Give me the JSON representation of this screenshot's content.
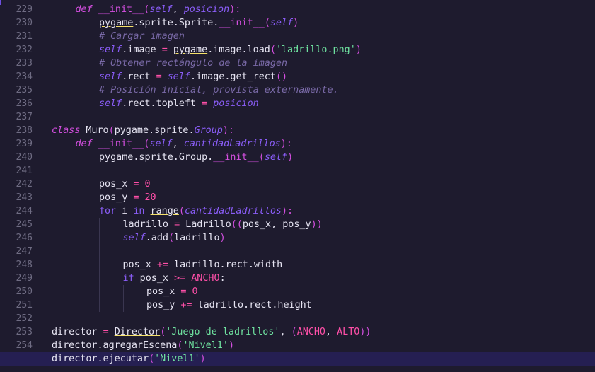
{
  "colors": {
    "background": "#1e1b2e",
    "active_line": "#251f52",
    "line_number": "#6f6c83",
    "keyword": "#d44fe0",
    "self": "#8a5df7",
    "string": "#6fe2a0",
    "number": "#ff4fa8",
    "comment": "#7a6aa8",
    "text": "#e6e4f2"
  },
  "editor": {
    "active_line": 255,
    "lines": [
      {
        "n": "229",
        "indent": 1,
        "tokens": [
          [
            "kw",
            "def "
          ],
          [
            "magic",
            "__init__"
          ],
          [
            "punc",
            "("
          ],
          [
            "self",
            "self"
          ],
          [
            "txt",
            ", "
          ],
          [
            "param",
            "posicion"
          ],
          [
            "punc",
            "):"
          ]
        ]
      },
      {
        "n": "230",
        "indent": 2,
        "tokens": [
          [
            "mod",
            "pygame"
          ],
          [
            "txt",
            ".sprite.Sprite."
          ],
          [
            "magic",
            "__init__"
          ],
          [
            "punc",
            "("
          ],
          [
            "self",
            "self"
          ],
          [
            "punc",
            ")"
          ]
        ]
      },
      {
        "n": "231",
        "indent": 2,
        "tokens": [
          [
            "cmt",
            "# Cargar imagen"
          ]
        ]
      },
      {
        "n": "232",
        "indent": 2,
        "tokens": [
          [
            "self",
            "self"
          ],
          [
            "txt",
            ".image "
          ],
          [
            "op",
            "="
          ],
          [
            "txt",
            " "
          ],
          [
            "mod",
            "pygame"
          ],
          [
            "txt",
            ".image.load"
          ],
          [
            "punc",
            "("
          ],
          [
            "str",
            "'ladrillo.png'"
          ],
          [
            "punc",
            ")"
          ]
        ]
      },
      {
        "n": "233",
        "indent": 2,
        "tokens": [
          [
            "cmt",
            "# Obtener rectángulo de la imagen"
          ]
        ]
      },
      {
        "n": "234",
        "indent": 2,
        "tokens": [
          [
            "self",
            "self"
          ],
          [
            "txt",
            ".rect "
          ],
          [
            "op",
            "="
          ],
          [
            "txt",
            " "
          ],
          [
            "self",
            "self"
          ],
          [
            "txt",
            ".image.get_rect"
          ],
          [
            "punc",
            "()"
          ]
        ]
      },
      {
        "n": "235",
        "indent": 2,
        "tokens": [
          [
            "cmt",
            "# Posición inicial, provista externamente."
          ]
        ]
      },
      {
        "n": "236",
        "indent": 2,
        "tokens": [
          [
            "self",
            "self"
          ],
          [
            "txt",
            ".rect.topleft "
          ],
          [
            "op",
            "="
          ],
          [
            "txt",
            " "
          ],
          [
            "param",
            "posicion"
          ]
        ]
      },
      {
        "n": "237",
        "indent": 0,
        "tokens": []
      },
      {
        "n": "238",
        "indent": 0,
        "tokens": [
          [
            "kw",
            "class "
          ],
          [
            "cls",
            "Muro"
          ],
          [
            "punc",
            "("
          ],
          [
            "mod",
            "pygame"
          ],
          [
            "txt",
            ".sprite."
          ],
          [
            "it",
            "Group"
          ],
          [
            "punc",
            "):"
          ]
        ]
      },
      {
        "n": "239",
        "indent": 1,
        "tokens": [
          [
            "kw",
            "def "
          ],
          [
            "magic",
            "__init__"
          ],
          [
            "punc",
            "("
          ],
          [
            "self",
            "self"
          ],
          [
            "txt",
            ", "
          ],
          [
            "param",
            "cantidadLadrillos"
          ],
          [
            "punc",
            "):"
          ]
        ]
      },
      {
        "n": "240",
        "indent": 2,
        "tokens": [
          [
            "mod",
            "pygame"
          ],
          [
            "txt",
            ".sprite.Group."
          ],
          [
            "magic",
            "__init__"
          ],
          [
            "punc",
            "("
          ],
          [
            "self",
            "self"
          ],
          [
            "punc",
            ")"
          ]
        ]
      },
      {
        "n": "241",
        "indent": 0,
        "tokens": []
      },
      {
        "n": "242",
        "indent": 2,
        "tokens": [
          [
            "txt",
            "pos_x "
          ],
          [
            "op",
            "="
          ],
          [
            "txt",
            " "
          ],
          [
            "num",
            "0"
          ]
        ]
      },
      {
        "n": "243",
        "indent": 2,
        "tokens": [
          [
            "txt",
            "pos_y "
          ],
          [
            "op",
            "="
          ],
          [
            "txt",
            " "
          ],
          [
            "num",
            "20"
          ]
        ]
      },
      {
        "n": "244",
        "indent": 2,
        "tokens": [
          [
            "kw2",
            "for"
          ],
          [
            "txt",
            " i "
          ],
          [
            "kw2",
            "in"
          ],
          [
            "txt",
            " "
          ],
          [
            "mod",
            "range"
          ],
          [
            "punc",
            "("
          ],
          [
            "param",
            "cantidadLadrillos"
          ],
          [
            "punc",
            "):"
          ]
        ]
      },
      {
        "n": "245",
        "indent": 3,
        "tokens": [
          [
            "txt",
            "ladrillo "
          ],
          [
            "op",
            "="
          ],
          [
            "txt",
            " "
          ],
          [
            "cls",
            "Ladrillo"
          ],
          [
            "punc",
            "(("
          ],
          [
            "txt",
            "pos_x, pos_y"
          ],
          [
            "punc",
            "))"
          ]
        ]
      },
      {
        "n": "246",
        "indent": 3,
        "tokens": [
          [
            "self",
            "self"
          ],
          [
            "txt",
            ".add"
          ],
          [
            "punc",
            "("
          ],
          [
            "txt",
            "ladrillo"
          ],
          [
            "punc",
            ")"
          ]
        ]
      },
      {
        "n": "247",
        "indent": 0,
        "tokens": []
      },
      {
        "n": "248",
        "indent": 3,
        "tokens": [
          [
            "txt",
            "pos_x "
          ],
          [
            "op",
            "+="
          ],
          [
            "txt",
            " ladrillo.rect.width"
          ]
        ]
      },
      {
        "n": "249",
        "indent": 3,
        "tokens": [
          [
            "kw2",
            "if"
          ],
          [
            "txt",
            " pos_x "
          ],
          [
            "op",
            ">="
          ],
          [
            "txt",
            " "
          ],
          [
            "const",
            "ANCHO"
          ],
          [
            "txt",
            ":"
          ]
        ]
      },
      {
        "n": "250",
        "indent": 4,
        "tokens": [
          [
            "txt",
            "pos_x "
          ],
          [
            "op",
            "="
          ],
          [
            "txt",
            " "
          ],
          [
            "num",
            "0"
          ]
        ]
      },
      {
        "n": "251",
        "indent": 4,
        "tokens": [
          [
            "txt",
            "pos_y "
          ],
          [
            "op",
            "+="
          ],
          [
            "txt",
            " ladrillo.rect.height"
          ]
        ]
      },
      {
        "n": "252",
        "indent": 0,
        "tokens": []
      },
      {
        "n": "253",
        "indent": 0,
        "tokens": [
          [
            "txt",
            "director "
          ],
          [
            "op",
            "="
          ],
          [
            "txt",
            " "
          ],
          [
            "cls",
            "Director"
          ],
          [
            "punc",
            "("
          ],
          [
            "str",
            "'Juego de ladrillos'"
          ],
          [
            "txt",
            ", "
          ],
          [
            "punc",
            "("
          ],
          [
            "const",
            "ANCHO"
          ],
          [
            "txt",
            ", "
          ],
          [
            "const",
            "ALTO"
          ],
          [
            "punc",
            "))"
          ]
        ]
      },
      {
        "n": "254",
        "indent": 0,
        "tokens": [
          [
            "txt",
            "director.agregarEscena"
          ],
          [
            "punc",
            "("
          ],
          [
            "str",
            "'Nivel1'"
          ],
          [
            "punc",
            ")"
          ]
        ]
      },
      {
        "n": "255",
        "indent": 0,
        "tokens": [
          [
            "txt",
            "director.ejecutar"
          ],
          [
            "punc",
            "("
          ],
          [
            "str",
            "'Nivel1'"
          ],
          [
            "punc",
            ")"
          ]
        ]
      }
    ]
  }
}
